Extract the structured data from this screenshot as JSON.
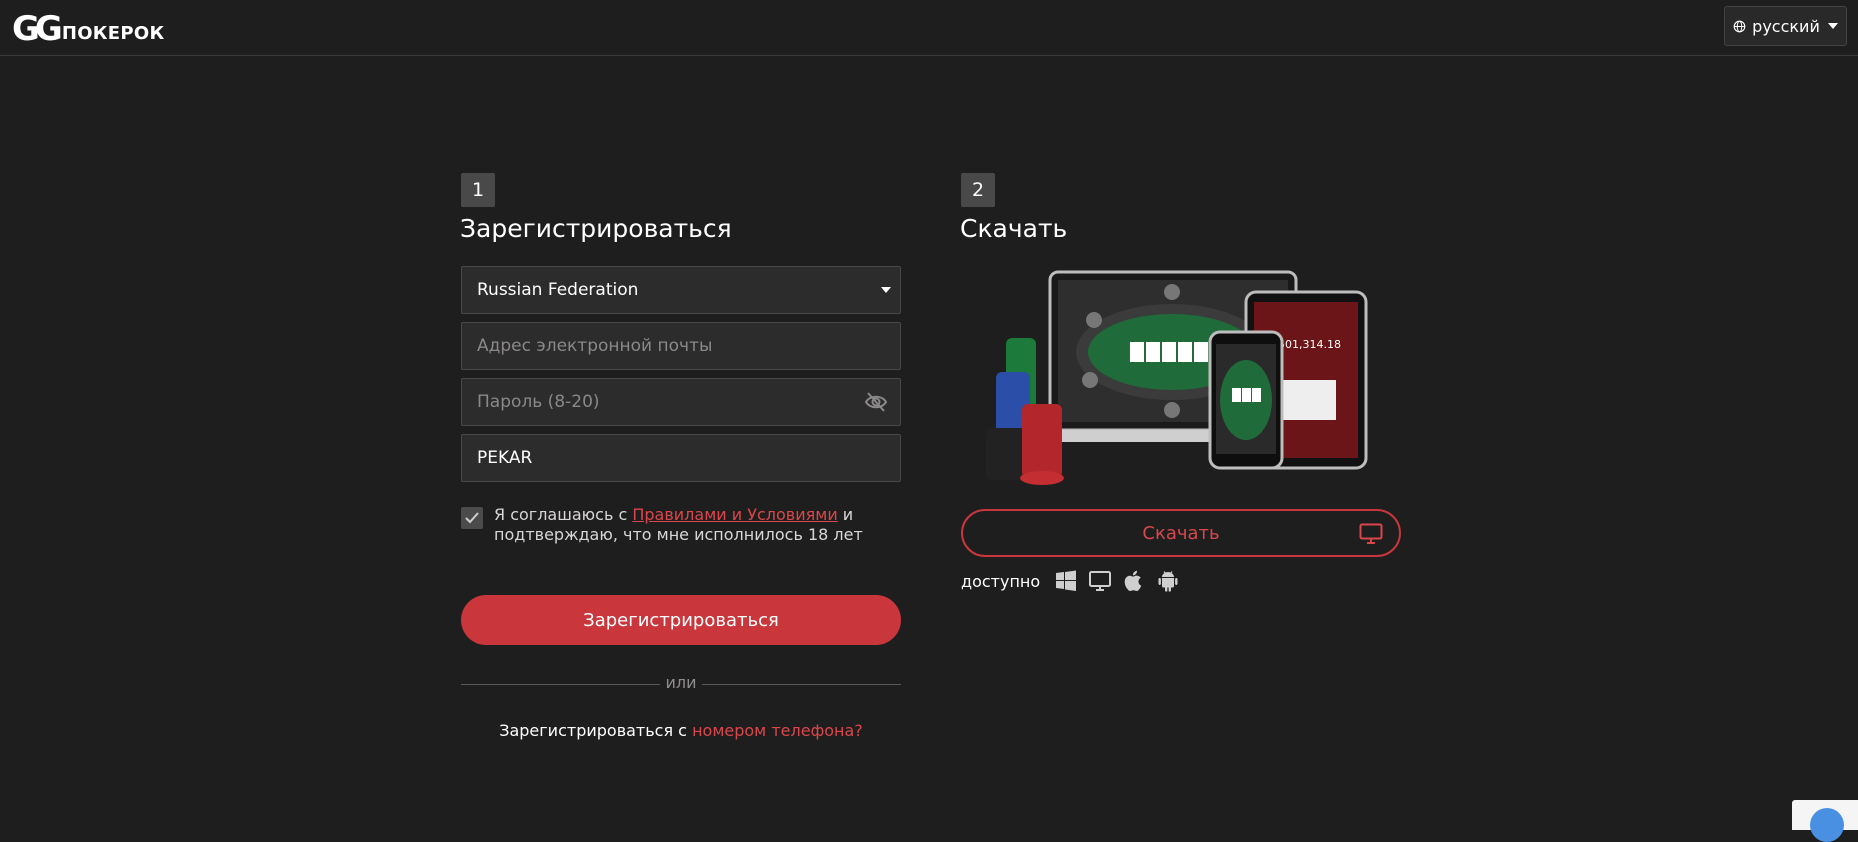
{
  "header": {
    "logo_mark": "GG",
    "logo_text": "ПОКЕРОК",
    "language": "русский"
  },
  "step1": {
    "number": "1",
    "title": "Зарегистрироваться",
    "country": "Russian Federation",
    "email_placeholder": "Адрес электронной почты",
    "password_placeholder": "Пароль (8-20)",
    "code_value": "PEKAR",
    "terms_before": "Я соглашаюсь с ",
    "terms_link": "Правилами и Условиями",
    "terms_after": " и подтверждаю, что мне исполнилось 18 лет",
    "register_button": "Зарегистрироваться",
    "divider": "или",
    "phone_prefix": "Зарегистрироваться с ",
    "phone_link": "номером телефона?"
  },
  "step2": {
    "number": "2",
    "title": "Скачать",
    "devices_image": {
      "jackpot_text": "$501,314.18"
    },
    "download_button": "Скачать",
    "available_label": "доступно",
    "platform_icons": [
      "windows-icon",
      "desktop-icon",
      "apple-icon",
      "android-icon"
    ]
  },
  "colors": {
    "background": "#1f1e1e",
    "accent": "#c9373c",
    "link": "#d9474c",
    "field_bg": "#2d2c2c",
    "field_border": "#4a4949"
  }
}
